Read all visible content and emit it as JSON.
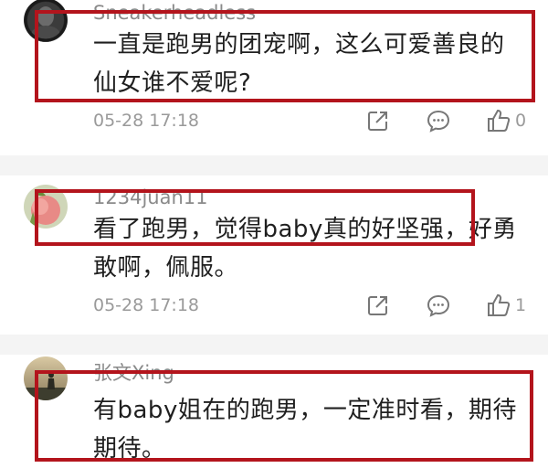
{
  "comments": [
    {
      "username": "Sneakerheadless",
      "text": "一直是跑男的团宠啊，这么可爱善良的仙女谁不爱呢?",
      "time": "05-28 17:18",
      "likes": "0",
      "avatar_icon": "avatar-dark-portrait-icon"
    },
    {
      "username": "1234juan11",
      "text": "看了跑男，觉得baby真的好坚强，好勇敢啊，佩服。",
      "time": "05-28 17:18",
      "likes": "1",
      "avatar_icon": "avatar-peach-icon"
    },
    {
      "username": "张文Xing",
      "text": "有baby姐在的跑男，一定准时看，期待期待。",
      "avatar_icon": "avatar-sunset-figure-icon"
    }
  ],
  "actions": {
    "share_icon": "share-icon",
    "reply_icon": "comment-icon",
    "like_icon": "thumbs-up-icon"
  },
  "colors": {
    "highlight_border": "#b3141c",
    "meta_text": "#9a9a9a",
    "divider_bg": "#f4f4f4"
  }
}
